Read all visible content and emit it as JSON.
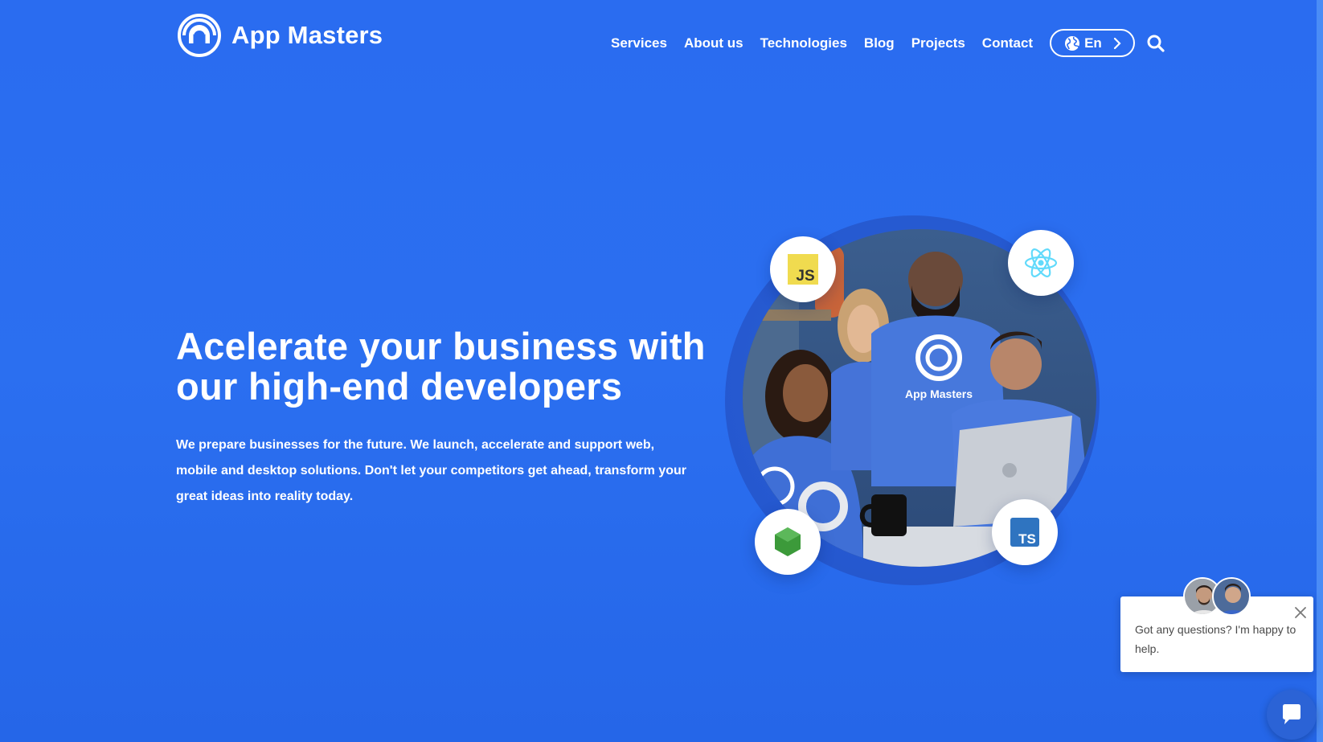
{
  "brand": {
    "name": "App Masters",
    "logo_icon": "app-masters-logo-icon"
  },
  "nav": {
    "items": [
      {
        "label": "Services"
      },
      {
        "label": "About us"
      },
      {
        "label": "Technologies"
      },
      {
        "label": "Blog"
      },
      {
        "label": "Projects"
      },
      {
        "label": "Contact"
      }
    ],
    "language": {
      "label": "En",
      "icon": "globe-icon"
    },
    "search_icon": "search-icon"
  },
  "hero": {
    "title_line1": "Acelerate your business with",
    "title_line2": "our high-end developers",
    "text_line1": "We prepare businesses for the future. We launch, accelerate and support web,",
    "text_line2": "mobile and desktop solutions. Don't let your competitors get ahead, transform your",
    "text_line3": "great ideas into reality today."
  },
  "illustration": {
    "shirt_text": "App Masters",
    "badges": [
      {
        "label": "JS",
        "icon": "javascript-icon"
      },
      {
        "label": "",
        "icon": "react-icon"
      },
      {
        "label": "",
        "icon": "nodejs-icon"
      },
      {
        "label": "TS",
        "icon": "typescript-icon"
      }
    ]
  },
  "chat": {
    "message": "Got any questions? I'm happy to help.",
    "close_icon": "close-icon",
    "launcher_icon": "chat-bubble-icon"
  },
  "colors": {
    "background": "#2a6cf0",
    "text": "#ffffff",
    "js_yellow": "#f0db4f",
    "react_cyan": "#61dafb",
    "node_green": "#3c9a3a",
    "ts_blue": "#2f74c0"
  }
}
